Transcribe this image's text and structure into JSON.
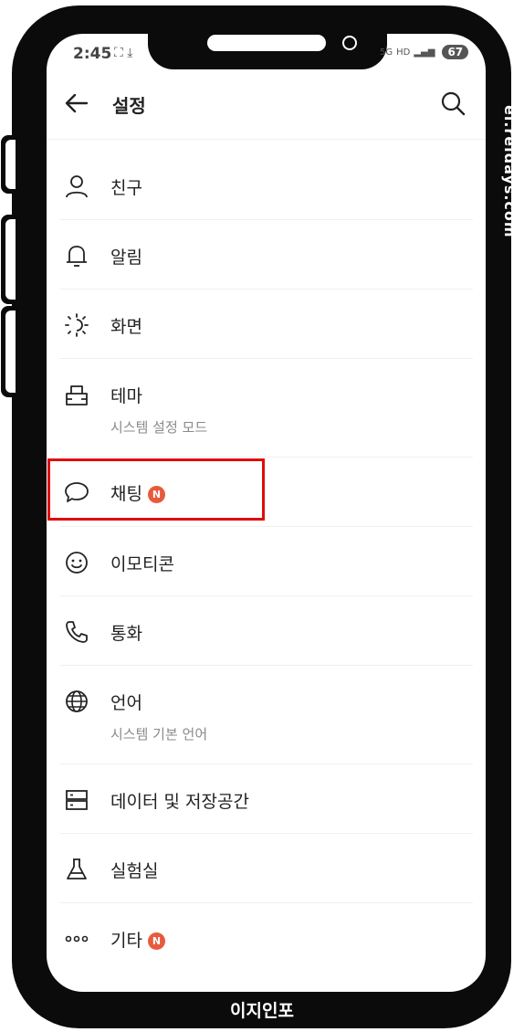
{
  "status_bar": {
    "time": "2:45",
    "left_icons": "⛶ ⤓",
    "network": "5G",
    "hd": "HD",
    "battery": "67"
  },
  "header": {
    "title": "설정",
    "back_icon": "back-arrow-icon",
    "search_icon": "search-icon"
  },
  "menu": [
    {
      "label": "친구",
      "icon": "person-icon"
    },
    {
      "label": "알림",
      "icon": "bell-icon"
    },
    {
      "label": "화면",
      "icon": "brightness-icon"
    },
    {
      "label": "테마",
      "sub": "시스템 설정 모드",
      "icon": "theme-icon"
    },
    {
      "label": "채팅",
      "badge": "N",
      "icon": "chat-bubble-icon"
    },
    {
      "label": "이모티콘",
      "icon": "emoticon-icon"
    },
    {
      "label": "통화",
      "icon": "phone-icon"
    },
    {
      "label": "언어",
      "sub": "시스템 기본 언어",
      "icon": "globe-icon"
    },
    {
      "label": "데이터 및 저장공간",
      "icon": "storage-icon"
    },
    {
      "label": "실험실",
      "icon": "flask-icon"
    },
    {
      "label": "기타",
      "badge": "N",
      "icon": "more-icon"
    }
  ],
  "watermark": "ei.reidays.com",
  "footer_brand": "이지인포",
  "colors": {
    "highlight_border": "#e10b0b",
    "badge": "#e85a3c",
    "frame": "#0b0b0b"
  }
}
